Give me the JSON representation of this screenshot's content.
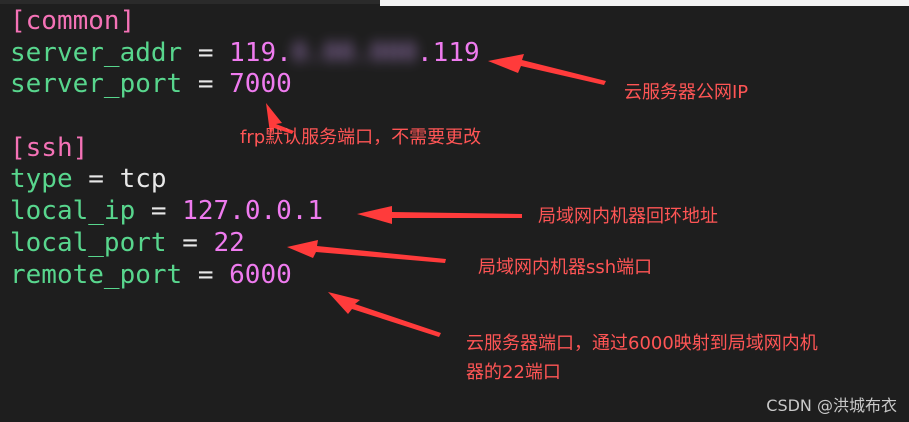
{
  "editor": {
    "lines": [
      {
        "section": "[common]"
      },
      {
        "key": "server_addr",
        "op": " = ",
        "value_pre": "119.",
        "value_blur": "0.00.000",
        "value_post": ".119"
      },
      {
        "key": "server_port",
        "op": " = ",
        "value": "7000"
      },
      {
        "blank": ""
      },
      {
        "section": "[ssh]"
      },
      {
        "key": "type",
        "op": " = ",
        "text": "tcp"
      },
      {
        "key": "local_ip",
        "op": " = ",
        "value": "127.0.0.1"
      },
      {
        "key": "local_port",
        "op": " = ",
        "value": "22"
      },
      {
        "key": "remote_port",
        "op": " = ",
        "value": "6000"
      }
    ]
  },
  "annotations": {
    "public_ip": "云服务器公网IP",
    "default_port": "frp默认服务端口，不需要更改",
    "loopback": "局域网内机器回环地址",
    "ssh_port": "局域网内机器ssh端口",
    "remote_line1": "云服务器端口，通过6000映射到局域网内机",
    "remote_line2": "器的22端口"
  },
  "watermark": "CSDN @洪城布衣",
  "colors": {
    "background": "#1e1e1e",
    "section": "#f472b6",
    "key": "#58d68d",
    "number": "#ef7bef",
    "annotation": "#ff5555"
  }
}
